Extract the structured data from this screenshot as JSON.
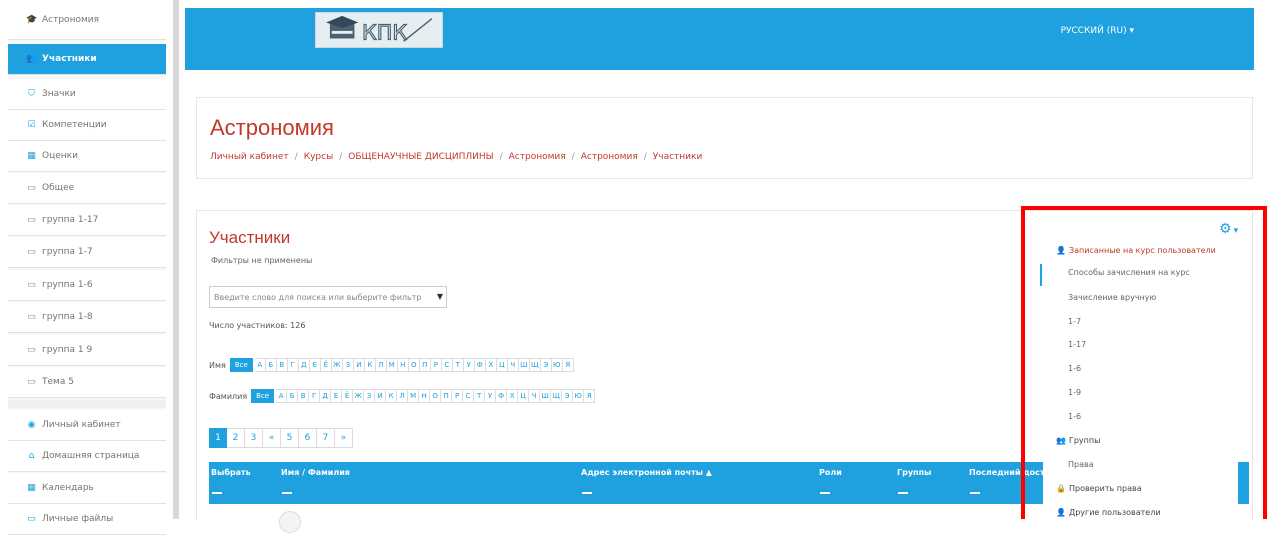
{
  "sidebar": {
    "items": [
      {
        "label": "Астрономия",
        "icon": "graduation-cap-icon",
        "glyph": "🎓",
        "active": false
      },
      {
        "label": "Участники",
        "icon": "users-icon",
        "glyph": "👥",
        "active": true
      },
      {
        "label": "Значки",
        "icon": "shield-icon",
        "glyph": "⛉",
        "active": false
      },
      {
        "label": "Компетенции",
        "icon": "check-square-icon",
        "glyph": "☑",
        "active": false
      },
      {
        "label": "Оценки",
        "icon": "table-icon",
        "glyph": "▦",
        "active": false
      },
      {
        "label": "Общее",
        "icon": "folder-icon",
        "glyph": "▭",
        "active": false
      },
      {
        "label": "группа 1-17",
        "icon": "folder-icon",
        "glyph": "▭",
        "active": false
      },
      {
        "label": "группа 1-7",
        "icon": "folder-icon",
        "glyph": "▭",
        "active": false
      },
      {
        "label": "группа 1-6",
        "icon": "folder-icon",
        "glyph": "▭",
        "active": false
      },
      {
        "label": "группа 1-8",
        "icon": "folder-icon",
        "glyph": "▭",
        "active": false
      },
      {
        "label": "группа 1 9",
        "icon": "folder-icon",
        "glyph": "▭",
        "active": false
      },
      {
        "label": "Тема 5",
        "icon": "folder-icon",
        "glyph": "▭",
        "active": false
      }
    ],
    "bottom_items": [
      {
        "label": "Личный кабинет",
        "icon": "dashboard-icon",
        "glyph": "◉"
      },
      {
        "label": "Домашняя страница",
        "icon": "home-icon",
        "glyph": "⌂"
      },
      {
        "label": "Календарь",
        "icon": "calendar-icon",
        "glyph": "▦"
      },
      {
        "label": "Личные файлы",
        "icon": "file-icon",
        "glyph": "▭"
      }
    ]
  },
  "navbar": {
    "language": "РУССКИЙ (RU) ▾",
    "logo_text": "КПК"
  },
  "header": {
    "title": "Астрономия",
    "breadcrumb": [
      "Личный кабинет",
      "Курсы",
      "ОБЩЕНАУЧНЫЕ ДИСЦИПЛИНЫ",
      "Астрономия",
      "Астрономия",
      "Участники"
    ]
  },
  "participants": {
    "title": "Участники",
    "filters_note": "Фильтры не применены",
    "search_placeholder": "Введите слово для поиска или выберите фильтр",
    "count_text": "Число участников: 126",
    "first_name_label": "Имя",
    "last_name_label": "Фамилия",
    "all_label": "Все",
    "letters": [
      "А",
      "Б",
      "В",
      "Г",
      "Д",
      "Е",
      "Ё",
      "Ж",
      "З",
      "И",
      "К",
      "Л",
      "М",
      "Н",
      "О",
      "П",
      "Р",
      "С",
      "Т",
      "У",
      "Ф",
      "Х",
      "Ц",
      "Ч",
      "Ш",
      "Щ",
      "Э",
      "Ю",
      "Я"
    ],
    "pages": [
      "1",
      "2",
      "3",
      "«",
      "5",
      "6",
      "7",
      "»"
    ],
    "active_page": "1",
    "columns": [
      "Выбрать",
      "Имя / Фамилия",
      "Адрес электронной почты ▲",
      "Роли",
      "Группы",
      "Последний доступ"
    ]
  },
  "settings_menu": {
    "gear_icon": "gear-icon",
    "items": [
      {
        "label": "Записанные на курс пользователи",
        "kind": "head",
        "icon": "user-plus-icon",
        "glyph": "👤"
      },
      {
        "label": "Способы зачисления на курс",
        "kind": "indent",
        "icon": "",
        "glyph": ""
      },
      {
        "label": "Зачисление вручную",
        "kind": "indent",
        "icon": "",
        "glyph": ""
      },
      {
        "label": "1-7",
        "kind": "indent",
        "icon": "",
        "glyph": ""
      },
      {
        "label": "1-17",
        "kind": "indent",
        "icon": "",
        "glyph": ""
      },
      {
        "label": "1-6",
        "kind": "indent",
        "icon": "",
        "glyph": ""
      },
      {
        "label": "1-9",
        "kind": "indent",
        "icon": "",
        "glyph": ""
      },
      {
        "label": "1-6",
        "kind": "indent",
        "icon": "",
        "glyph": ""
      },
      {
        "label": "Группы",
        "kind": "head",
        "icon": "users-icon",
        "glyph": "👥"
      },
      {
        "label": "Права",
        "kind": "indent",
        "icon": "",
        "glyph": ""
      },
      {
        "label": "Проверить права",
        "kind": "head",
        "icon": "lock-icon",
        "glyph": "🔒"
      },
      {
        "label": "Другие пользователи",
        "kind": "head",
        "icon": "user-plus-icon",
        "glyph": "👤"
      }
    ]
  },
  "colors": {
    "accent": "#1ea1de",
    "title_red": "#c0392b",
    "highlight_red": "#ff0000"
  }
}
